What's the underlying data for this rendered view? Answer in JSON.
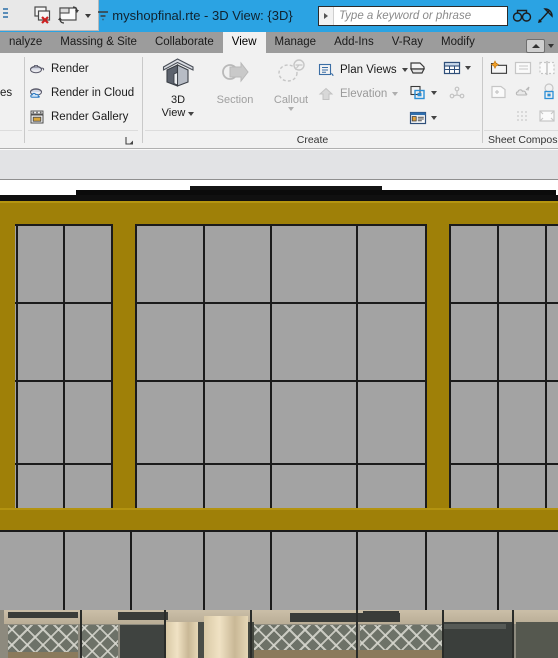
{
  "window": {
    "title": "myshopfinal.rte - 3D View: {3D}",
    "accent_blue": "#2BA3E3",
    "qat": [
      {
        "name": "modify-tool-icon",
        "label": "Modify"
      },
      {
        "name": "close-hidden-windows-icon",
        "label": "Close Hidden Windows"
      },
      {
        "name": "switch-windows-icon",
        "label": "Switch Windows"
      },
      {
        "name": "switch-windows-dropdown",
        "label": ""
      },
      {
        "name": "customize-qat-icon",
        "label": "Customize Quick Access Toolbar"
      }
    ],
    "search": {
      "placeholder": "Type a keyword or phrase",
      "value": ""
    },
    "title_icons": [
      {
        "name": "infocenter-search-icon",
        "label": "Search"
      },
      {
        "name": "subscription-center-icon",
        "label": "Subscription Center"
      }
    ]
  },
  "tabs": [
    {
      "label": "nalyze",
      "active": false
    },
    {
      "label": "Massing & Site",
      "active": false
    },
    {
      "label": "Collaborate",
      "active": false
    },
    {
      "label": "View",
      "active": true
    },
    {
      "label": "Manage",
      "active": false
    },
    {
      "label": "Add-Ins",
      "active": false
    },
    {
      "label": "V-Ray",
      "active": false
    },
    {
      "label": "Modify",
      "active": false
    }
  ],
  "tabbar_right": {
    "minimize_ribbon_label": "Minimize Ribbon"
  },
  "ribbon": {
    "graphics_panel": {
      "clipped_label": "es",
      "launcher_label": "Graphics panel dialog launcher"
    },
    "presentation_panel": {
      "items": [
        {
          "label": "Render",
          "icon": "teapot-render-icon",
          "enabled": true
        },
        {
          "label": "Render in Cloud",
          "icon": "cloud-render-icon",
          "enabled": true
        },
        {
          "label": "Render Gallery",
          "icon": "render-gallery-icon",
          "enabled": true
        }
      ]
    },
    "create_panel": {
      "label": "Create",
      "big_buttons": [
        {
          "label_line1": "3D",
          "label_line2": "View",
          "icon": "house-3d-view-icon",
          "enabled": true,
          "dropdown": true
        },
        {
          "label_line1": "Section",
          "label_line2": "",
          "icon": "section-icon",
          "enabled": false,
          "dropdown": false
        },
        {
          "label_line1": "Callout",
          "label_line2": "",
          "icon": "callout-icon",
          "enabled": false,
          "dropdown": true
        }
      ],
      "stack_items": [
        {
          "label": "Plan Views",
          "icon": "plan-views-icon",
          "enabled": true,
          "dropdown": true
        },
        {
          "label": "Elevation",
          "icon": "elevation-icon",
          "enabled": false,
          "dropdown": true
        }
      ],
      "icon_buttons": [
        {
          "name": "drafting-view-icon",
          "enabled": true,
          "dropdown": false
        },
        {
          "name": "schedules-icon",
          "enabled": true,
          "dropdown": true
        },
        {
          "name": "duplicate-view-icon",
          "enabled": true,
          "dropdown": true
        },
        {
          "name": "scope-box-icon",
          "enabled": false,
          "dropdown": false
        },
        {
          "name": "legend-icon",
          "enabled": true,
          "dropdown": true
        }
      ]
    },
    "sheet_composition_panel": {
      "label": "Sheet Compos",
      "icon_buttons": [
        {
          "name": "new-sheet-icon",
          "enabled": true
        },
        {
          "name": "view-placeholder-icon",
          "enabled": false
        },
        {
          "name": "matchline-icon",
          "enabled": false
        },
        {
          "name": "title-block-icon",
          "enabled": false
        },
        {
          "name": "revision-cloud-icon",
          "enabled": false
        },
        {
          "name": "view-reference-icon",
          "enabled": false
        },
        {
          "name": "guide-grid-icon",
          "enabled": false
        },
        {
          "name": "viewport-icon",
          "enabled": false
        }
      ]
    }
  },
  "viewport": {
    "name": "3D View: {3D}",
    "background": "#FFFFFF",
    "materials": {
      "structure_gold": "#9F8008",
      "panel_grey": "#A3A3A3",
      "mullion_black": "#1B1B1B",
      "recess_dark": "#4A4A4A",
      "door_wood": "#B0722F",
      "door_frame_brown": "#9C5437",
      "glass_door_frame": "#C07A1E",
      "glass_pane": "#4E5250",
      "roof_edge": "#101010"
    },
    "elements": [
      {
        "name": "roof-edge",
        "type": "roof"
      },
      {
        "name": "upper-beam",
        "type": "structural-beam"
      },
      {
        "name": "lower-beam",
        "type": "structural-beam"
      },
      {
        "name": "column-left",
        "type": "column"
      },
      {
        "name": "column-center",
        "type": "column"
      },
      {
        "name": "column-right",
        "type": "column"
      },
      {
        "name": "curtain-wall-panels",
        "type": "curtain-wall"
      },
      {
        "name": "wood-door-left",
        "type": "door"
      },
      {
        "name": "wood-door-right",
        "type": "door"
      },
      {
        "name": "glazed-double-door",
        "type": "door"
      }
    ]
  },
  "render_strip": {
    "name": "rendered-elevation-strip",
    "description": "Rendered building elevation with mashrabiya lattice screens"
  }
}
